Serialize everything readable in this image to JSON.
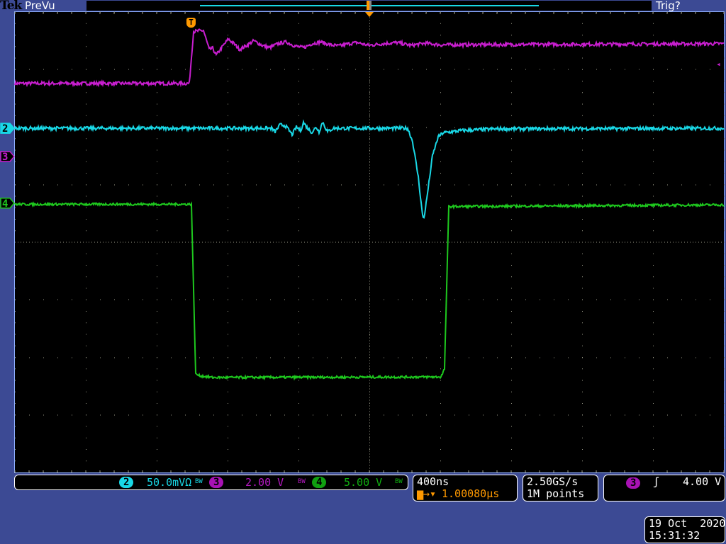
{
  "header": {
    "brand": "Tek",
    "mode": "PreVu",
    "trigger_status": "Trig?"
  },
  "colors": {
    "ch2": "#19d8e6",
    "ch3": "#c81ecf",
    "ch4": "#1ec81e",
    "trigger": "#ff9900",
    "bg": "#3c4a94"
  },
  "channels": [
    {
      "id": "2",
      "scale": "50.0mVΩ",
      "bw": "BW",
      "color": "#19d8e6"
    },
    {
      "id": "3",
      "scale": "2.00 V",
      "bw": "BW",
      "color": "#c81ecf"
    },
    {
      "id": "4",
      "scale": "5.00 V",
      "bw": "BW",
      "color": "#1ec81e"
    }
  ],
  "timebase": {
    "scale": "400ns",
    "trigger_position": "1.00080µs"
  },
  "acquisition": {
    "sample_rate": "2.50GS/s",
    "record_length": "1M points"
  },
  "trigger": {
    "source": "3",
    "slope": "rising",
    "level": "4.00 V",
    "level_div": 3.1
  },
  "datetime": {
    "date": "19 Oct  2020",
    "time": "15:31:32"
  },
  "markers": {
    "trigger_marker": "T"
  },
  "waveforms_note_units": "time and value in graticule divisions from screen center",
  "waveforms": [
    {
      "channel": "3",
      "color": "#c81ecf",
      "noise": 0.03,
      "points": [
        [
          -5,
          2.76
        ],
        [
          -2.54,
          2.76
        ],
        [
          -2.48,
          3.66
        ],
        [
          -2.34,
          3.68
        ],
        [
          -2.26,
          3.35
        ],
        [
          -2.21,
          3.37
        ],
        [
          -2.16,
          3.25
        ],
        [
          -2.09,
          3.37
        ],
        [
          -1.99,
          3.53
        ],
        [
          -1.91,
          3.45
        ],
        [
          -1.83,
          3.35
        ],
        [
          -1.73,
          3.42
        ],
        [
          -1.63,
          3.5
        ],
        [
          -1.51,
          3.42
        ],
        [
          -1.41,
          3.38
        ],
        [
          -1.29,
          3.45
        ],
        [
          -1.17,
          3.48
        ],
        [
          -1.05,
          3.41
        ],
        [
          -0.93,
          3.38
        ],
        [
          -0.81,
          3.45
        ],
        [
          -0.69,
          3.48
        ],
        [
          -0.55,
          3.43
        ],
        [
          -0.43,
          3.41
        ],
        [
          -0.29,
          3.45
        ],
        [
          -0.17,
          3.47
        ],
        [
          -0.01,
          3.42
        ],
        [
          0.19,
          3.45
        ],
        [
          0.39,
          3.47
        ],
        [
          0.59,
          3.42
        ],
        [
          0.79,
          3.46
        ],
        [
          0.99,
          3.43
        ],
        [
          5,
          3.45
        ]
      ]
    },
    {
      "channel": "2",
      "color": "#19d8e6",
      "noise": 0.03,
      "points": [
        [
          -5,
          1.98
        ],
        [
          -1.38,
          1.98
        ],
        [
          -1.33,
          1.92
        ],
        [
          -1.26,
          2.04
        ],
        [
          -1.19,
          2.03
        ],
        [
          -1.13,
          1.94
        ],
        [
          -1.09,
          1.87
        ],
        [
          -1.03,
          2.0
        ],
        [
          -0.97,
          1.94
        ],
        [
          -0.93,
          2.08
        ],
        [
          -0.87,
          1.98
        ],
        [
          -0.81,
          1.91
        ],
        [
          -0.75,
          2.0
        ],
        [
          -0.71,
          1.92
        ],
        [
          -0.66,
          2.09
        ],
        [
          -0.59,
          1.92
        ],
        [
          -0.51,
          1.98
        ],
        [
          0.54,
          1.98
        ],
        [
          0.61,
          1.75
        ],
        [
          0.69,
          1.13
        ],
        [
          0.75,
          0.46
        ],
        [
          0.77,
          0.42
        ],
        [
          0.81,
          0.76
        ],
        [
          0.89,
          1.5
        ],
        [
          0.97,
          1.83
        ],
        [
          1.04,
          1.9
        ],
        [
          1.29,
          1.94
        ],
        [
          1.79,
          1.97
        ],
        [
          5,
          1.98
        ]
      ]
    },
    {
      "channel": "4",
      "color": "#1ec81e",
      "noise": 0.02,
      "points": [
        [
          -5,
          0.66
        ],
        [
          -2.51,
          0.66
        ],
        [
          -2.45,
          -2.29
        ],
        [
          -2.39,
          -2.32
        ],
        [
          -2.21,
          -2.35
        ],
        [
          1.01,
          -2.34
        ],
        [
          1.06,
          -2.2
        ],
        [
          1.12,
          0.62
        ],
        [
          5,
          0.65
        ]
      ]
    }
  ],
  "ground_markers": [
    {
      "channel": "2",
      "level_div": 1.98
    },
    {
      "channel": "3",
      "level_div": 1.49
    },
    {
      "channel": "4",
      "level_div": 0.68
    }
  ]
}
